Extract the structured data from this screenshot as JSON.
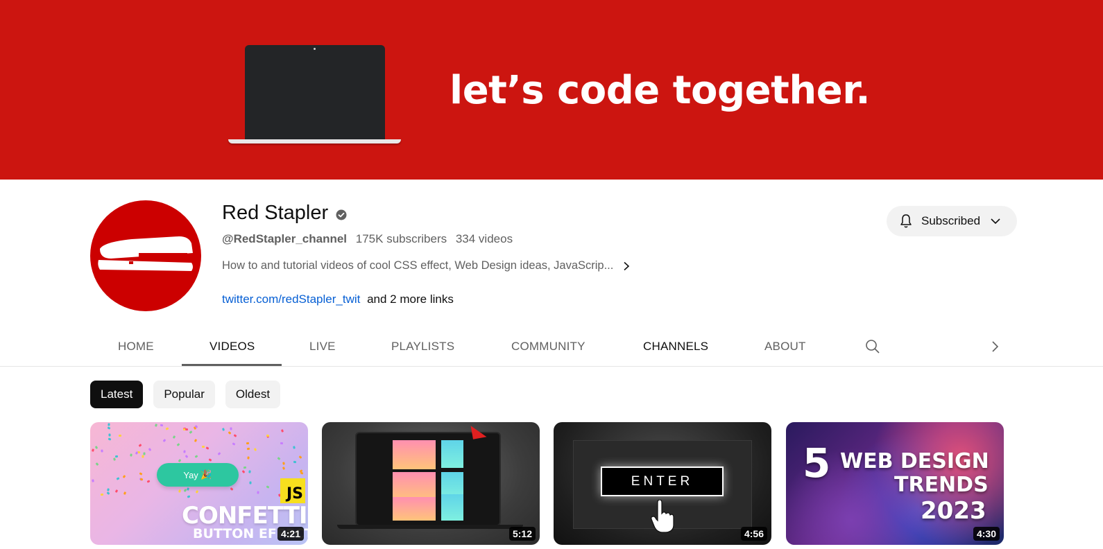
{
  "banner": {
    "tagline": "let’s code together."
  },
  "channel": {
    "name": "Red Stapler",
    "handle": "@RedStapler_channel",
    "subscribers": "175K subscribers",
    "videos": "334 videos",
    "description": "How to and tutorial videos of cool CSS effect, Web Design ideas, JavaScrip...",
    "link": "twitter.com/redStapler_twit",
    "more_links": "and 2 more links",
    "subscribe_label": "Subscribed"
  },
  "tabs": [
    {
      "label": "HOME"
    },
    {
      "label": "VIDEOS"
    },
    {
      "label": "LIVE"
    },
    {
      "label": "PLAYLISTS"
    },
    {
      "label": "COMMUNITY"
    },
    {
      "label": "CHANNELS"
    },
    {
      "label": "ABOUT"
    }
  ],
  "active_tab": "VIDEOS",
  "chips": [
    {
      "label": "Latest"
    },
    {
      "label": "Popular"
    },
    {
      "label": "Oldest"
    }
  ],
  "active_chip": "Latest",
  "videos": [
    {
      "duration": "4:21",
      "thumb_text": [
        "Yay",
        "JS",
        "CONFETTI",
        "BUTTON EFFECT"
      ]
    },
    {
      "duration": "5:12"
    },
    {
      "duration": "4:56",
      "thumb_text": [
        "ENTER"
      ]
    },
    {
      "duration": "4:30",
      "thumb_text": [
        "5",
        "WEB DESIGN",
        "TRENDS",
        "2023"
      ]
    }
  ],
  "colors": {
    "banner": "#cc1510",
    "avatar": "#cc0000",
    "link": "#065fd4",
    "chip_active": "#0f0f0f",
    "chip": "#f2f2f2"
  },
  "icons": [
    "verified-icon",
    "chevron-right-icon",
    "bell-icon",
    "chevron-down-icon",
    "search-icon",
    "stapler-icon",
    "hand-cursor-icon"
  ]
}
